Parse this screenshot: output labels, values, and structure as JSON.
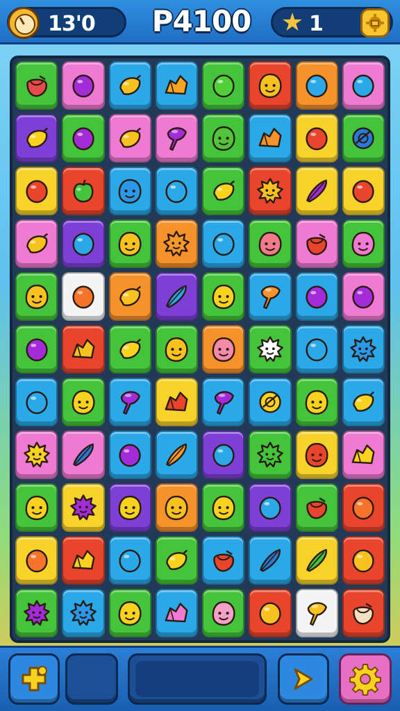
{
  "hud": {
    "timer": "13'0",
    "score": "P4100",
    "moves": "1"
  },
  "colors": {
    "green": "#43c43a",
    "pink": "#ef7ad2",
    "blue": "#2aa8e8",
    "orange": "#f5922a",
    "red": "#e8452c",
    "yellow": "#f6d22a",
    "purple": "#7d3fd6",
    "white": "#f4f4f4",
    "lime": "#8ad42e"
  },
  "board": {
    "rows": [
      [
        {
          "bg": "green",
          "piece": "drum",
          "color": "#e84a4a"
        },
        {
          "bg": "pink",
          "piece": "gem",
          "color": "#a42bd8"
        },
        {
          "bg": "blue",
          "piece": "lemon",
          "color": "#f7c21f"
        },
        {
          "bg": "blue",
          "piece": "shard",
          "color": "#f5a521"
        },
        {
          "bg": "green",
          "piece": "gem",
          "color": "#52d038"
        },
        {
          "bg": "red",
          "piece": "face",
          "color": "#f7c21f"
        },
        {
          "bg": "orange",
          "piece": "gem",
          "color": "#2aa8e8"
        },
        {
          "bg": "pink",
          "piece": "gem",
          "color": "#2aa8e8"
        }
      ],
      [
        {
          "bg": "purple",
          "piece": "lemon",
          "color": "#f7d21f"
        },
        {
          "bg": "green",
          "piece": "gem",
          "color": "#a42bd8"
        },
        {
          "bg": "pink",
          "piece": "lemon",
          "color": "#f7c21f"
        },
        {
          "bg": "pink",
          "piece": "cone",
          "color": "#a42bd8"
        },
        {
          "bg": "green",
          "piece": "face",
          "color": "#52c43a"
        },
        {
          "bg": "blue",
          "piece": "shard",
          "color": "#f5922a"
        },
        {
          "bg": "yellow",
          "piece": "gem",
          "color": "#e8452c"
        },
        {
          "bg": "green",
          "piece": "orb",
          "color": "#2a78d8"
        }
      ],
      [
        {
          "bg": "yellow",
          "piece": "gem",
          "color": "#e8452c"
        },
        {
          "bg": "red",
          "piece": "apple",
          "color": "#43c43a"
        },
        {
          "bg": "blue",
          "piece": "face",
          "color": "#2a98e8"
        },
        {
          "bg": "blue",
          "piece": "gem",
          "color": "#2aa8e8"
        },
        {
          "bg": "green",
          "piece": "lemon",
          "color": "#f7d21f"
        },
        {
          "bg": "red",
          "piece": "sun",
          "color": "#f7c21f"
        },
        {
          "bg": "yellow",
          "piece": "feather",
          "color": "#a42bd8"
        },
        {
          "bg": "yellow",
          "piece": "gem",
          "color": "#e8452c"
        }
      ],
      [
        {
          "bg": "pink",
          "piece": "lemon",
          "color": "#f7c21f"
        },
        {
          "bg": "purple",
          "piece": "gem",
          "color": "#2aa8e8"
        },
        {
          "bg": "green",
          "piece": "face",
          "color": "#f7c21f"
        },
        {
          "bg": "orange",
          "piece": "sun",
          "color": "#f59a2a"
        },
        {
          "bg": "blue",
          "piece": "gem",
          "color": "#2aa8e8"
        },
        {
          "bg": "green",
          "piece": "face",
          "color": "#f07a8a"
        },
        {
          "bg": "pink",
          "piece": "drum",
          "color": "#e8452c"
        },
        {
          "bg": "green",
          "piece": "face",
          "color": "#ef7ad2"
        }
      ],
      [
        {
          "bg": "green",
          "piece": "face",
          "color": "#f7c21f"
        },
        {
          "bg": "white",
          "piece": "gem",
          "color": "#f5742a"
        },
        {
          "bg": "orange",
          "piece": "lemon",
          "color": "#f7c21f"
        },
        {
          "bg": "purple",
          "piece": "feather",
          "color": "#2aa8e8"
        },
        {
          "bg": "green",
          "piece": "face",
          "color": "#f7d21f"
        },
        {
          "bg": "blue",
          "piece": "cone",
          "color": "#f5922a"
        },
        {
          "bg": "blue",
          "piece": "gem",
          "color": "#a42bd8"
        },
        {
          "bg": "pink",
          "piece": "gem",
          "color": "#a42bd8"
        }
      ],
      [
        {
          "bg": "green",
          "piece": "gem",
          "color": "#a42bd8"
        },
        {
          "bg": "red",
          "piece": "shard",
          "color": "#f7c21f"
        },
        {
          "bg": "green",
          "piece": "lemon",
          "color": "#f7d21f"
        },
        {
          "bg": "green",
          "piece": "face",
          "color": "#f7c21f"
        },
        {
          "bg": "orange",
          "piece": "face",
          "color": "#f58aa8"
        },
        {
          "bg": "green",
          "piece": "sun",
          "color": "#ffffff"
        },
        {
          "bg": "blue",
          "piece": "gem",
          "color": "#2aa8e8"
        },
        {
          "bg": "blue",
          "piece": "sun",
          "color": "#2a98e8"
        }
      ],
      [
        {
          "bg": "blue",
          "piece": "gem",
          "color": "#2aa8e8"
        },
        {
          "bg": "green",
          "piece": "face",
          "color": "#f7d21f"
        },
        {
          "bg": "blue",
          "piece": "cone",
          "color": "#a42bd8"
        },
        {
          "bg": "yellow",
          "piece": "shard",
          "color": "#e8452c"
        },
        {
          "bg": "blue",
          "piece": "cone",
          "color": "#a42bd8"
        },
        {
          "bg": "blue",
          "piece": "orb",
          "color": "#f7d21f"
        },
        {
          "bg": "green",
          "piece": "face",
          "color": "#f7d21f"
        },
        {
          "bg": "blue",
          "piece": "lemon",
          "color": "#f7d21f"
        }
      ],
      [
        {
          "bg": "pink",
          "piece": "sun",
          "color": "#f7d21f"
        },
        {
          "bg": "pink",
          "piece": "feather",
          "color": "#2a78d8"
        },
        {
          "bg": "blue",
          "piece": "gem",
          "color": "#a42bd8"
        },
        {
          "bg": "blue",
          "piece": "feather",
          "color": "#f59a2a"
        },
        {
          "bg": "purple",
          "piece": "gem",
          "color": "#2aa8e8"
        },
        {
          "bg": "green",
          "piece": "sun",
          "color": "#43c43a"
        },
        {
          "bg": "yellow",
          "piece": "face",
          "color": "#e8452c"
        },
        {
          "bg": "pink",
          "piece": "shard",
          "color": "#f7d21f"
        }
      ],
      [
        {
          "bg": "green",
          "piece": "face",
          "color": "#f7d21f"
        },
        {
          "bg": "yellow",
          "piece": "sun",
          "color": "#a42bd8"
        },
        {
          "bg": "purple",
          "piece": "face",
          "color": "#f7d21f"
        },
        {
          "bg": "orange",
          "piece": "face",
          "color": "#f7c21f"
        },
        {
          "bg": "green",
          "piece": "face",
          "color": "#f7d21f"
        },
        {
          "bg": "purple",
          "piece": "gem",
          "color": "#2aa8e8"
        },
        {
          "bg": "green",
          "piece": "drum",
          "color": "#e8452c"
        },
        {
          "bg": "red",
          "piece": "gem",
          "color": "#f5742a"
        }
      ],
      [
        {
          "bg": "yellow",
          "piece": "gem",
          "color": "#f5742a"
        },
        {
          "bg": "red",
          "piece": "shard",
          "color": "#f7d21f"
        },
        {
          "bg": "blue",
          "piece": "gem",
          "color": "#2aa8e8"
        },
        {
          "bg": "green",
          "piece": "lemon",
          "color": "#f7d21f"
        },
        {
          "bg": "blue",
          "piece": "drum",
          "color": "#e8452c"
        },
        {
          "bg": "blue",
          "piece": "feather",
          "color": "#2a78d8"
        },
        {
          "bg": "yellow",
          "piece": "feather",
          "color": "#43c43a"
        },
        {
          "bg": "red",
          "piece": "gem",
          "color": "#f7c21f"
        }
      ],
      [
        {
          "bg": "green",
          "piece": "sun",
          "color": "#a42bd8"
        },
        {
          "bg": "blue",
          "piece": "sun",
          "color": "#2a98e8"
        },
        {
          "bg": "green",
          "piece": "face",
          "color": "#f7d21f"
        },
        {
          "bg": "blue",
          "piece": "shard",
          "color": "#ef7ad2"
        },
        {
          "bg": "green",
          "piece": "face",
          "color": "#f5a0c8"
        },
        {
          "bg": "red",
          "piece": "gem",
          "color": "#f7c21f"
        },
        {
          "bg": "white",
          "piece": "cone",
          "color": "#f7c21f"
        },
        {
          "bg": "red",
          "piece": "drum",
          "color": "#f4e0c0"
        }
      ]
    ]
  },
  "bottom": {
    "add_icon": "plus-icon",
    "next_icon": "arrow-right-icon",
    "settings_icon": "gear-icon"
  }
}
